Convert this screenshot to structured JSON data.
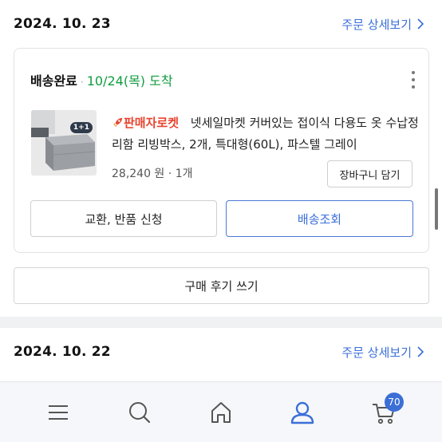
{
  "orders": [
    {
      "date": "2024. 10. 23",
      "detail_link": "주문 상세보기",
      "status": "배송완료",
      "status_separator": "·",
      "arrival": "10/24(목) 도착",
      "rocket_tag": "판매자로켓",
      "product_name": "넷세일마켓 커버있는 접이식 다용도 옷 수납정리함 리빙박스, 2개, 특대형(60L), 파스텔 그레이",
      "badge": "1+1",
      "price": "28,240 원",
      "price_separator": "·",
      "quantity": "1개",
      "add_to_cart": "장바구니 담기",
      "exchange_return": "교환, 반품 신청",
      "delivery_tracking": "배송조회",
      "write_review": "구매 후기 쓰기"
    },
    {
      "date": "2024. 10. 22",
      "detail_link": "주문 상세보기"
    }
  ],
  "bottom_nav": {
    "items": [
      {
        "icon": "menu-icon"
      },
      {
        "icon": "search-icon"
      },
      {
        "icon": "home-icon"
      },
      {
        "icon": "user-icon"
      },
      {
        "icon": "cart-icon"
      }
    ],
    "cart_count": "70"
  },
  "colors": {
    "accent_blue": "#3a6fd8",
    "arrival_green": "#0f9d3f",
    "rocket_red": "#e8442f"
  }
}
